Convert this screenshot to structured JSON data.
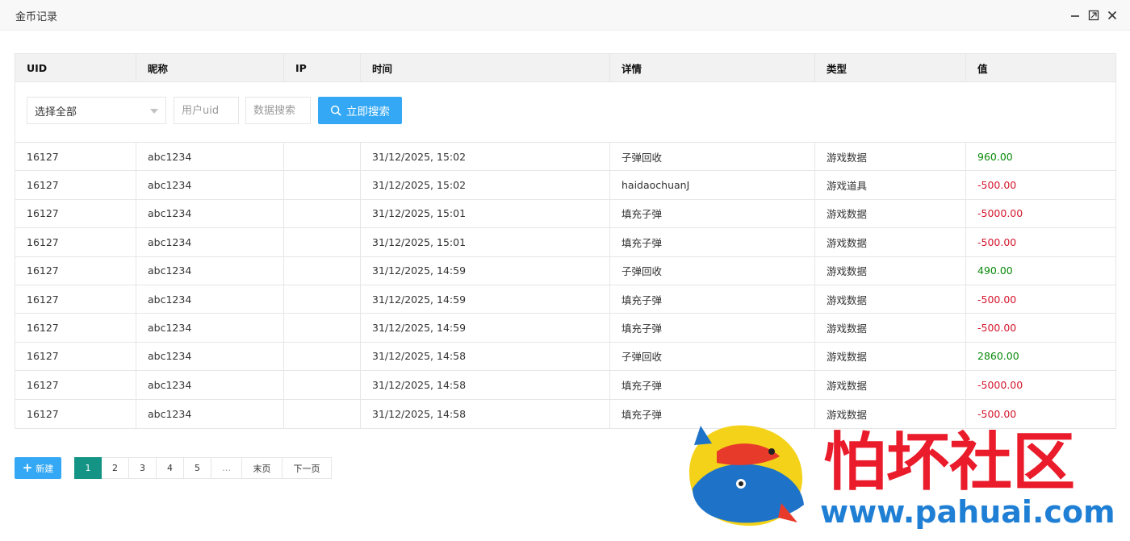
{
  "window": {
    "title": "金币记录"
  },
  "table": {
    "headers": [
      "UID",
      "昵称",
      "IP",
      "时间",
      "详情",
      "类型",
      "值"
    ],
    "rows": [
      {
        "uid": "16127",
        "nickname": "abc1234",
        "ip": "",
        "time": "31/12/2025, 15:02",
        "detail": "子弹回收",
        "type": "游戏数据",
        "value": "960.00",
        "sign": "pos"
      },
      {
        "uid": "16127",
        "nickname": "abc1234",
        "ip": "",
        "time": "31/12/2025, 15:02",
        "detail": "haidaochuanJ",
        "type": "游戏道具",
        "value": "-500.00",
        "sign": "neg"
      },
      {
        "uid": "16127",
        "nickname": "abc1234",
        "ip": "",
        "time": "31/12/2025, 15:01",
        "detail": "填充子弹",
        "type": "游戏数据",
        "value": "-5000.00",
        "sign": "neg"
      },
      {
        "uid": "16127",
        "nickname": "abc1234",
        "ip": "",
        "time": "31/12/2025, 15:01",
        "detail": "填充子弹",
        "type": "游戏数据",
        "value": "-500.00",
        "sign": "neg"
      },
      {
        "uid": "16127",
        "nickname": "abc1234",
        "ip": "",
        "time": "31/12/2025, 14:59",
        "detail": "子弹回收",
        "type": "游戏数据",
        "value": "490.00",
        "sign": "pos"
      },
      {
        "uid": "16127",
        "nickname": "abc1234",
        "ip": "",
        "time": "31/12/2025, 14:59",
        "detail": "填充子弹",
        "type": "游戏数据",
        "value": "-500.00",
        "sign": "neg"
      },
      {
        "uid": "16127",
        "nickname": "abc1234",
        "ip": "",
        "time": "31/12/2025, 14:59",
        "detail": "填充子弹",
        "type": "游戏数据",
        "value": "-500.00",
        "sign": "neg"
      },
      {
        "uid": "16127",
        "nickname": "abc1234",
        "ip": "",
        "time": "31/12/2025, 14:58",
        "detail": "子弹回收",
        "type": "游戏数据",
        "value": "2860.00",
        "sign": "pos"
      },
      {
        "uid": "16127",
        "nickname": "abc1234",
        "ip": "",
        "time": "31/12/2025, 14:58",
        "detail": "填充子弹",
        "type": "游戏数据",
        "value": "-5000.00",
        "sign": "neg"
      },
      {
        "uid": "16127",
        "nickname": "abc1234",
        "ip": "",
        "time": "31/12/2025, 14:58",
        "detail": "填充子弹",
        "type": "游戏数据",
        "value": "-500.00",
        "sign": "neg"
      }
    ]
  },
  "filters": {
    "select_value": "选择全部",
    "uid_placeholder": "用户uid",
    "data_placeholder": "数据搜索",
    "search_label": "立即搜索"
  },
  "actions": {
    "new_label": "新建"
  },
  "pagination": {
    "pages": [
      "1",
      "2",
      "3",
      "4",
      "5"
    ],
    "active": "1",
    "ellipsis": "…",
    "last_label": "末页",
    "next_label": "下一页"
  },
  "watermark": {
    "brand_text": "怕坏社区",
    "url_text": "www.pahuai.com"
  },
  "colors": {
    "accent": "#34a8f4",
    "page_active": "#149484",
    "positive": "#0a8a0a",
    "negative": "#d4162c"
  },
  "icons": {
    "minimize": "minimize-icon",
    "maximize": "maximize-icon",
    "close": "close-icon",
    "search": "search-icon",
    "dropdown": "chevron-down-icon",
    "plus": "plus-icon"
  }
}
